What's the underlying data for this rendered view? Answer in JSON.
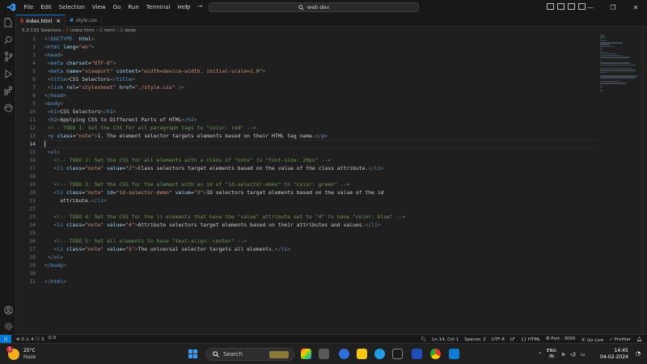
{
  "titlebar": {
    "menu": [
      "File",
      "Edit",
      "Selection",
      "View",
      "Go",
      "Run",
      "Terminal",
      "Help"
    ],
    "search_text": "web dev"
  },
  "tabs": [
    {
      "label": "index.html",
      "icon": "html-icon",
      "active": true
    },
    {
      "label": "style.css",
      "icon": "css-icon",
      "active": false
    }
  ],
  "breadcrumb": [
    "5.3 CSS Selectors",
    "index.html",
    "html",
    "body"
  ],
  "editor": {
    "current_line": 14,
    "lines": [
      [
        [
          "p",
          "<!"
        ],
        [
          "t",
          "DOCTYPE"
        ],
        [
          "",
          "  "
        ],
        [
          "a",
          "html"
        ],
        [
          "p",
          ">"
        ]
      ],
      [
        [
          "p",
          "<"
        ],
        [
          "t",
          "html"
        ],
        [
          "",
          " "
        ],
        [
          "a",
          "lang"
        ],
        [
          "",
          "="
        ],
        [
          "s",
          "\"en\""
        ],
        [
          "p",
          ">"
        ]
      ],
      [
        [
          "p",
          "<"
        ],
        [
          "t",
          "head"
        ],
        [
          "p",
          ">"
        ]
      ],
      [
        [
          "",
          " "
        ],
        [
          "p",
          "<"
        ],
        [
          "t",
          "meta"
        ],
        [
          "",
          " "
        ],
        [
          "a",
          "charset"
        ],
        [
          "",
          "="
        ],
        [
          "s",
          "\"UTF-8\""
        ],
        [
          "p",
          ">"
        ]
      ],
      [
        [
          "",
          " "
        ],
        [
          "p",
          "<"
        ],
        [
          "t",
          "meta"
        ],
        [
          "",
          " "
        ],
        [
          "a",
          "name"
        ],
        [
          "",
          "="
        ],
        [
          "s",
          "\"viewport\""
        ],
        [
          "",
          " "
        ],
        [
          "a",
          "content"
        ],
        [
          "",
          "="
        ],
        [
          "s",
          "\"width=device-width, initial-scale=1.0\""
        ],
        [
          "p",
          ">"
        ]
      ],
      [
        [
          "",
          " "
        ],
        [
          "p",
          "<"
        ],
        [
          "t",
          "title"
        ],
        [
          "p",
          ">"
        ],
        [
          "",
          "CSS Selectors"
        ],
        [
          "p",
          "</"
        ],
        [
          "t",
          "title"
        ],
        [
          "p",
          ">"
        ]
      ],
      [
        [
          "",
          " "
        ],
        [
          "p",
          "<"
        ],
        [
          "t",
          "link"
        ],
        [
          "",
          " "
        ],
        [
          "a",
          "rel"
        ],
        [
          "",
          "="
        ],
        [
          "s",
          "\"stylesheet\""
        ],
        [
          "",
          " "
        ],
        [
          "a",
          "href"
        ],
        [
          "",
          "="
        ],
        [
          "s",
          "\"./style.css\""
        ],
        [
          "",
          " "
        ],
        [
          "p",
          "/>"
        ]
      ],
      [
        [
          "p",
          "</"
        ],
        [
          "t",
          "head"
        ],
        [
          "p",
          ">"
        ]
      ],
      [
        [
          "p",
          "<"
        ],
        [
          "t",
          "body"
        ],
        [
          "p",
          ">"
        ]
      ],
      [
        [
          "",
          " "
        ],
        [
          "p",
          "<"
        ],
        [
          "t",
          "h1"
        ],
        [
          "p",
          ">"
        ],
        [
          "",
          "CSS Selectors"
        ],
        [
          "p",
          "</"
        ],
        [
          "t",
          "h1"
        ],
        [
          "p",
          ">"
        ]
      ],
      [
        [
          "",
          " "
        ],
        [
          "p",
          "<"
        ],
        [
          "t",
          "h2"
        ],
        [
          "p",
          ">"
        ],
        [
          "",
          "Applying CSS to Different Parts of HTML"
        ],
        [
          "p",
          "</"
        ],
        [
          "t",
          "h2"
        ],
        [
          "p",
          ">"
        ]
      ],
      [
        [
          "",
          " "
        ],
        [
          "c",
          "<!-- TODO 1: Set the CSS for all paragraph tags to \"color: red\" -->"
        ]
      ],
      [
        [
          "",
          " "
        ],
        [
          "p",
          "<"
        ],
        [
          "t",
          "p"
        ],
        [
          "",
          " "
        ],
        [
          "a",
          "class"
        ],
        [
          "",
          "="
        ],
        [
          "s",
          "\"note\""
        ],
        [
          "p",
          ">"
        ],
        [
          "",
          "1. The element selector targets elements based on their HTML tag name."
        ],
        [
          "p",
          "</"
        ],
        [
          "t",
          "p"
        ],
        [
          "p",
          ">"
        ]
      ],
      [],
      [
        [
          "",
          " "
        ],
        [
          "p",
          "<"
        ],
        [
          "t",
          "ol"
        ],
        [
          "p",
          ">"
        ]
      ],
      [
        [
          "",
          "   "
        ],
        [
          "c",
          "<!-- TODO 2: Set the CSS for all elements with a class of \"note\" to \"font-size: 20px\" -->"
        ]
      ],
      [
        [
          "",
          "   "
        ],
        [
          "p",
          "<"
        ],
        [
          "t",
          "li"
        ],
        [
          "",
          " "
        ],
        [
          "a",
          "class"
        ],
        [
          "",
          "="
        ],
        [
          "s",
          "\"note\""
        ],
        [
          "",
          " "
        ],
        [
          "a",
          "value"
        ],
        [
          "",
          "="
        ],
        [
          "s",
          "\"2\""
        ],
        [
          "p",
          ">"
        ],
        [
          "",
          "Class selectors target elements based on the value of the class attribute."
        ],
        [
          "p",
          "</"
        ],
        [
          "t",
          "li"
        ],
        [
          "p",
          ">"
        ]
      ],
      [],
      [
        [
          "",
          "   "
        ],
        [
          "c",
          "<!-- TODO 3: Set the CSS for the element with an id of \"id-selector-demo\" to \"color: green\" -->"
        ]
      ],
      [
        [
          "",
          "   "
        ],
        [
          "p",
          "<"
        ],
        [
          "t",
          "li"
        ],
        [
          "",
          " "
        ],
        [
          "a",
          "class"
        ],
        [
          "",
          "="
        ],
        [
          "s",
          "\"note\""
        ],
        [
          "",
          " "
        ],
        [
          "a",
          "id"
        ],
        [
          "",
          "="
        ],
        [
          "s",
          "\"id-selector-demo\""
        ],
        [
          "",
          " "
        ],
        [
          "a",
          "value"
        ],
        [
          "",
          "="
        ],
        [
          "s",
          "\"3\""
        ],
        [
          "p",
          ">"
        ],
        [
          "",
          "ID selectors target elements based on the value of the id"
        ]
      ],
      [
        [
          "",
          "     attribute."
        ],
        [
          "p",
          "</"
        ],
        [
          "t",
          "li"
        ],
        [
          "p",
          ">"
        ]
      ],
      [],
      [
        [
          "",
          "   "
        ],
        [
          "c",
          "<!-- TODO 4: Set the CSS for the li elements that have the \"value\" attribute set to \"4\" to have \"color: blue\" -->"
        ]
      ],
      [
        [
          "",
          "   "
        ],
        [
          "p",
          "<"
        ],
        [
          "t",
          "li"
        ],
        [
          "",
          " "
        ],
        [
          "a",
          "class"
        ],
        [
          "",
          "="
        ],
        [
          "s",
          "\"note\""
        ],
        [
          "",
          " "
        ],
        [
          "a",
          "value"
        ],
        [
          "",
          "="
        ],
        [
          "s",
          "\"4\""
        ],
        [
          "p",
          ">"
        ],
        [
          "",
          "Attribute selectors target elements based on their attributes and values."
        ],
        [
          "p",
          "</"
        ],
        [
          "t",
          "li"
        ],
        [
          "p",
          ">"
        ]
      ],
      [],
      [
        [
          "",
          "   "
        ],
        [
          "c",
          "<!-- TODO 5: Set all elements to have \"text-align: center\" -->"
        ]
      ],
      [
        [
          "",
          "   "
        ],
        [
          "p",
          "<"
        ],
        [
          "t",
          "li"
        ],
        [
          "",
          " "
        ],
        [
          "a",
          "class"
        ],
        [
          "",
          "="
        ],
        [
          "s",
          "\"note\""
        ],
        [
          "",
          " "
        ],
        [
          "a",
          "value"
        ],
        [
          "",
          "="
        ],
        [
          "s",
          "\"5\""
        ],
        [
          "p",
          ">"
        ],
        [
          "",
          "The universal selector targets all elements."
        ],
        [
          "p",
          "</"
        ],
        [
          "t",
          "li"
        ],
        [
          "p",
          ">"
        ]
      ],
      [
        [
          "",
          " "
        ],
        [
          "p",
          "</"
        ],
        [
          "t",
          "ol"
        ],
        [
          "p",
          ">"
        ]
      ],
      [
        [
          "p",
          "</"
        ],
        [
          "t",
          "body"
        ],
        [
          "p",
          ">"
        ]
      ],
      [],
      [
        [
          "p",
          "</"
        ],
        [
          "t",
          "html"
        ],
        [
          "p",
          ">"
        ]
      ]
    ]
  },
  "statusbar": {
    "errors": "0",
    "warnings": "4",
    "info": "3",
    "ports": "0",
    "position": "Ln 14, Col 1",
    "spaces": "Spaces: 2",
    "encoding": "UTF-8",
    "eol": "LF",
    "language": "HTML",
    "port": "Port : 3000",
    "golive": "Go Live",
    "prettier": "Prettier"
  },
  "taskbar": {
    "temperature": "25°C",
    "condition": "Haze",
    "weather_badge": "1",
    "search_label": "Search",
    "lang_top": "ENG",
    "lang_bottom": "IN",
    "time": "14:45",
    "date": "04-02-2024"
  },
  "colors": {
    "accent": "#0078d4",
    "tag": "#569cd6",
    "attribute": "#9cdcfe",
    "string": "#ce9178",
    "comment": "#6a9955"
  }
}
